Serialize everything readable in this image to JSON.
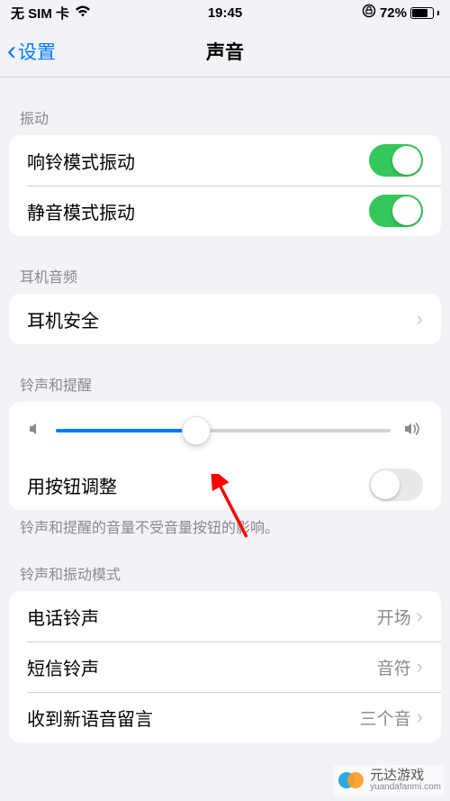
{
  "status": {
    "carrier": "无 SIM 卡",
    "time": "19:45",
    "battery_pct": "72%"
  },
  "nav": {
    "back_label": "设置",
    "title": "声音"
  },
  "sections": {
    "vibration": {
      "header": "振动",
      "ring_vibrate": {
        "label": "响铃模式振动",
        "on": true
      },
      "silent_vibrate": {
        "label": "静音模式振动",
        "on": true
      }
    },
    "headphone": {
      "header": "耳机音频",
      "safety": {
        "label": "耳机安全"
      }
    },
    "ringer": {
      "header": "铃声和提醒",
      "volume_percent": 42,
      "change_with_buttons": {
        "label": "用按钮调整",
        "on": false
      },
      "footer": "铃声和提醒的音量不受音量按钮的影响。"
    },
    "patterns": {
      "header": "铃声和振动模式",
      "ringtone": {
        "label": "电话铃声",
        "value": "开场"
      },
      "text_tone": {
        "label": "短信铃声",
        "value": "音符"
      },
      "voicemail": {
        "label": "收到新语音留言",
        "value": "三个音"
      }
    }
  },
  "watermark": {
    "brand": "元达游戏",
    "url": "yuandafanmi.com"
  }
}
